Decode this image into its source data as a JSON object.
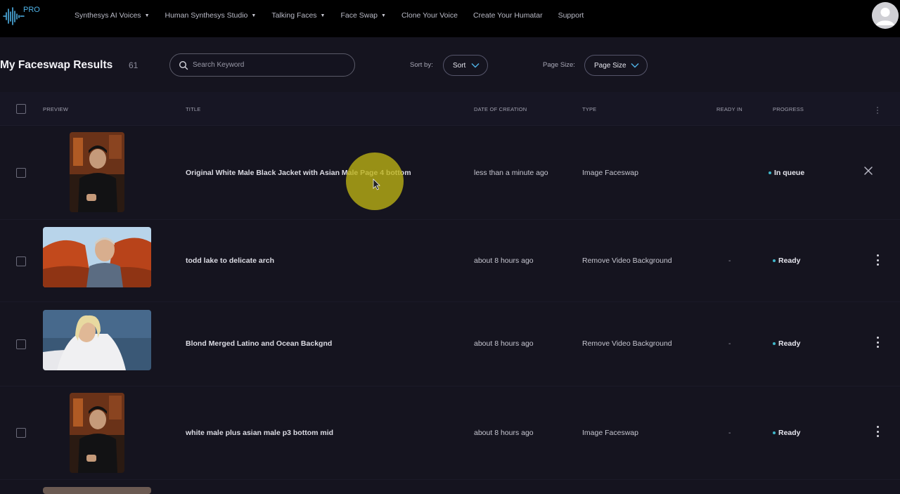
{
  "nav": {
    "logo_badge": "PRO",
    "items": [
      {
        "label": "Synthesys AI Voices",
        "dropdown": true
      },
      {
        "label": "Human Synthesys Studio",
        "dropdown": true
      },
      {
        "label": "Talking Faces",
        "dropdown": true
      },
      {
        "label": "Face Swap",
        "dropdown": true
      },
      {
        "label": "Clone Your Voice",
        "dropdown": false
      },
      {
        "label": "Create Your Humatar",
        "dropdown": false
      },
      {
        "label": "Support",
        "dropdown": false
      }
    ]
  },
  "header": {
    "title": "My Faceswap Results",
    "count": "61",
    "search_placeholder": "Search Keyword",
    "sort_label": "Sort by:",
    "sort_value": "Sort",
    "page_size_label": "Page Size:",
    "page_size_value": "Page Size"
  },
  "table": {
    "columns": {
      "preview": "PREVIEW",
      "title": "TITLE",
      "date": "DATE OF CREATION",
      "type": "TYPE",
      "ready_in": "READY IN",
      "progress": "PROGRESS"
    },
    "rows": [
      {
        "title": "Original White Male Black Jacket with Asian Male Page 4 bottom",
        "date": "less than a minute ago",
        "type": "Image Faceswap",
        "ready_in": "",
        "progress": "In queue"
      },
      {
        "title": "todd lake to delicate arch",
        "date": "about 8 hours ago",
        "type": "Remove Video Background",
        "ready_in": "-",
        "progress": "Ready"
      },
      {
        "title": "Blond Merged Latino and Ocean Backgnd",
        "date": "about 8 hours ago",
        "type": "Remove Video Background",
        "ready_in": "-",
        "progress": "Ready"
      },
      {
        "title": "white male plus asian male p3 bottom mid",
        "date": "about 8 hours ago",
        "type": "Image Faceswap",
        "ready_in": "-",
        "progress": "Ready"
      }
    ]
  },
  "colors": {
    "accent": "#4fb3e8",
    "status_dot": "#3fb6c9",
    "cursor_halo": "#beb414"
  },
  "icons": [
    "waveform-logo-icon",
    "search-icon",
    "chevron-down-icon",
    "user-avatar-icon",
    "close-icon",
    "more-vertical-icon",
    "mouse-cursor-icon"
  ]
}
